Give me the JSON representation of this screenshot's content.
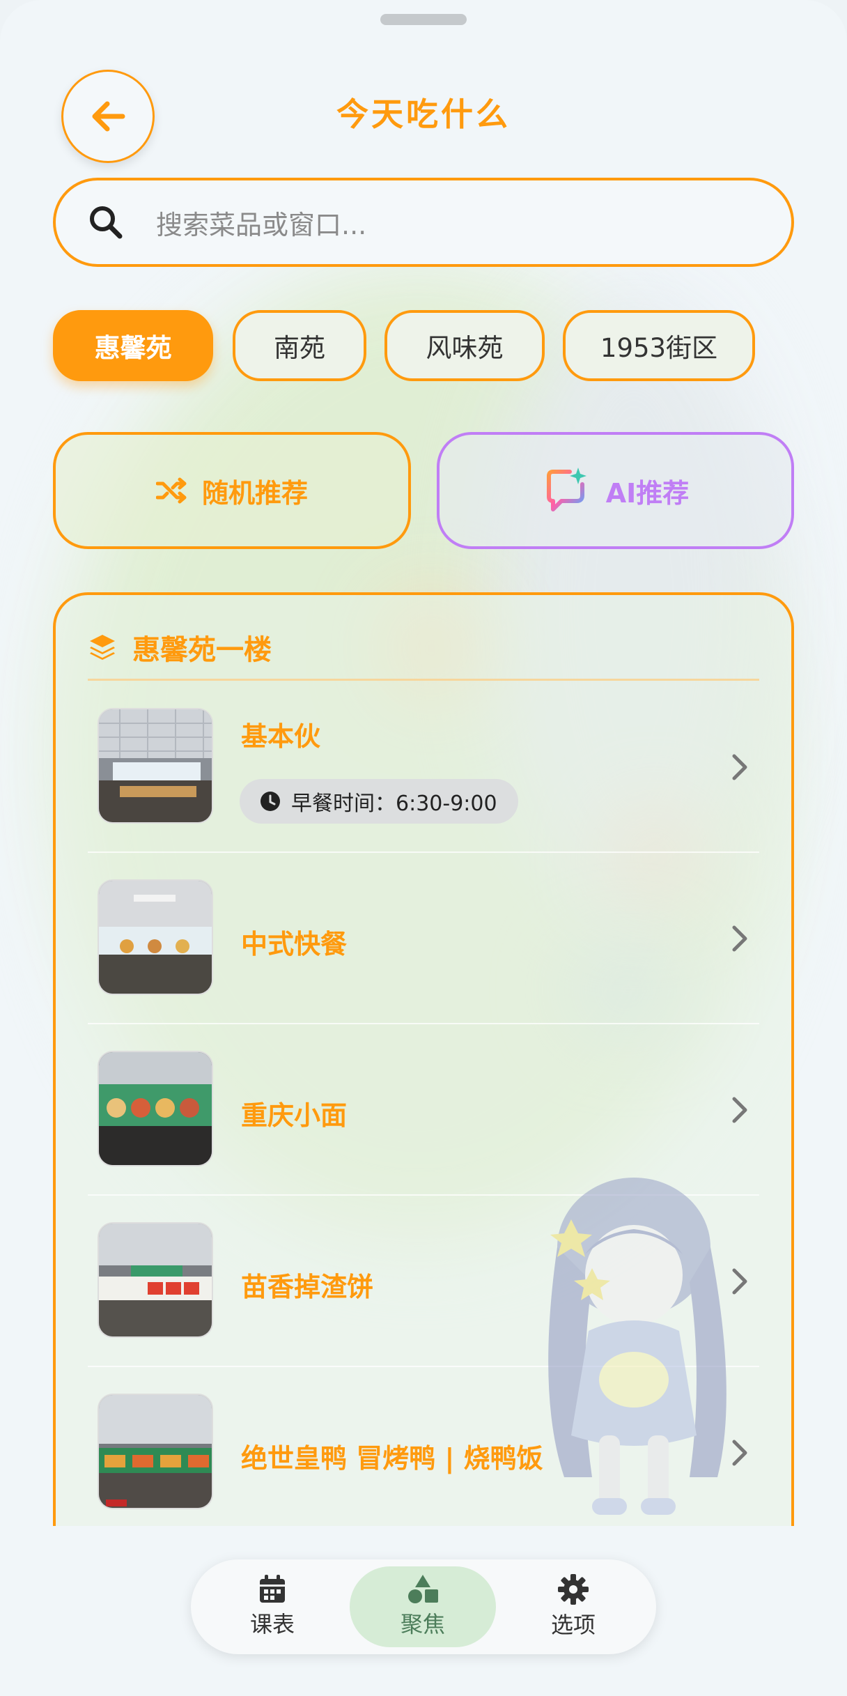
{
  "header": {
    "back_icon": "arrow-left-icon",
    "title": "今天吃什么"
  },
  "search": {
    "icon": "search-icon",
    "placeholder": "搜索菜品或窗口..."
  },
  "canteen_tabs": [
    {
      "label": "惠馨苑",
      "active": true
    },
    {
      "label": "南苑",
      "active": false
    },
    {
      "label": "风味苑",
      "active": false
    },
    {
      "label": "1953街区",
      "active": false
    }
  ],
  "recommend": {
    "random_label": "随机推荐",
    "random_icon": "shuffle-icon",
    "ai_label": "AI推荐",
    "ai_icon": "ai-chat-sparkle-icon"
  },
  "floor_section": {
    "icon": "layers-icon",
    "title": "惠馨苑一楼",
    "stalls": [
      {
        "name": "基本伙",
        "badge": "早餐时间：6:30-9:00"
      },
      {
        "name": "中式快餐"
      },
      {
        "name": "重庆小面"
      },
      {
        "name": "苗香掉渣饼"
      },
      {
        "name": "绝世皇鸭 冒烤鸭 | 烧鸭饭"
      }
    ]
  },
  "bottom_nav": [
    {
      "label": "课表",
      "icon": "calendar-icon",
      "active": false
    },
    {
      "label": "聚焦",
      "icon": "shapes-icon",
      "active": true
    },
    {
      "label": "选项",
      "icon": "gear-icon",
      "active": false
    }
  ],
  "colors": {
    "accent": "#ff9a0e",
    "ai_accent": "#c07ef5",
    "background": "#f1f6f9",
    "nav_active": "#d6ecd6"
  }
}
